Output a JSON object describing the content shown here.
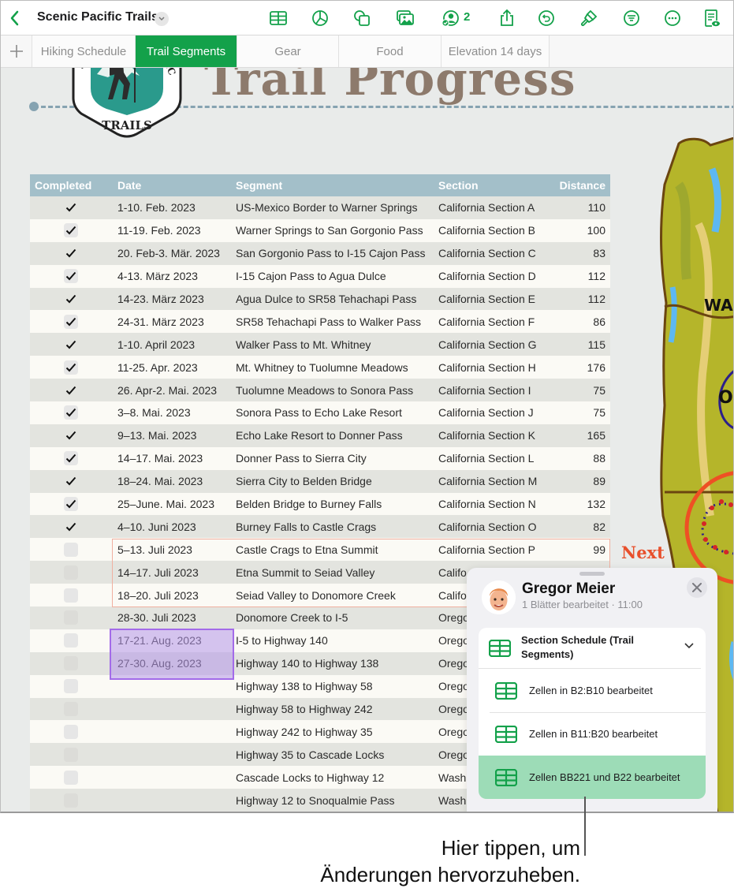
{
  "toolbar": {
    "back_icon": "chevron-left-icon",
    "title": "Scenic Pacific Trails",
    "title_menu_icon": "chevron-down-icon",
    "icons": [
      "table-icon",
      "chart-icon",
      "shapes-icon",
      "media-icon",
      "collaboration-icon",
      "share-icon",
      "undo-icon",
      "format-brush-icon",
      "filter-icon",
      "more-icon",
      "reading-view-icon"
    ],
    "collaborator_count": "2",
    "accent_color": "#13a14a"
  },
  "tabs": {
    "add_icon": "plus-icon",
    "items": [
      {
        "label": "Hiking Schedule",
        "active": false
      },
      {
        "label": "Trail Segments",
        "active": true
      },
      {
        "label": "Gear",
        "active": false
      },
      {
        "label": "Food",
        "active": false
      },
      {
        "label": "Elevation 14 days",
        "active": false
      }
    ]
  },
  "canvas": {
    "title": "Trail Progress",
    "logo": {
      "top_text": "SCENIC PACIFIC",
      "bottom_text": "TRAILS"
    },
    "map_labels": [
      "WA",
      "O"
    ],
    "next_label": "Next"
  },
  "table": {
    "headers": [
      "Completed",
      "Date",
      "Segment",
      "Section",
      "Distance"
    ],
    "rows": [
      {
        "completed": true,
        "date": "1-10. Feb. 2023",
        "segment": "US-Mexico Border to Warner Springs",
        "section": "California Section A",
        "distance": "110"
      },
      {
        "completed": true,
        "date": "11-19. Feb. 2023",
        "segment": "Warner Springs to San Gorgonio Pass",
        "section": "California Section B",
        "distance": "100"
      },
      {
        "completed": true,
        "date": "20. Feb-3. Mär. 2023",
        "segment": "San Gorgonio Pass to I-15 Cajon Pass",
        "section": "California Section C",
        "distance": "83"
      },
      {
        "completed": true,
        "date": "4-13. März 2023",
        "segment": "I-15 Cajon Pass to Agua Dulce",
        "section": "California Section D",
        "distance": "112"
      },
      {
        "completed": true,
        "date": "14-23. März 2023",
        "segment": "Agua Dulce to SR58 Tehachapi Pass",
        "section": "California Section E",
        "distance": "112"
      },
      {
        "completed": true,
        "date": "24-31. März 2023",
        "segment": "SR58 Tehachapi Pass to Walker Pass",
        "section": "California Section F",
        "distance": "86"
      },
      {
        "completed": true,
        "date": "1-10. April 2023",
        "segment": "Walker Pass to Mt. Whitney",
        "section": "California Section G",
        "distance": "115"
      },
      {
        "completed": true,
        "date": "11-25. Apr. 2023",
        "segment": "Mt. Whitney to Tuolumne Meadows",
        "section": "California Section H",
        "distance": "176"
      },
      {
        "completed": true,
        "date": "26. Apr-2. Mai. 2023",
        "segment": "Tuolumne Meadows to Sonora Pass",
        "section": "California Section I",
        "distance": "75"
      },
      {
        "completed": true,
        "date": "3–8. Mai. 2023",
        "segment": "Sonora Pass to Echo Lake Resort",
        "section": "California Section J",
        "distance": "75"
      },
      {
        "completed": true,
        "date": "9–13. Mai. 2023",
        "segment": "Echo Lake Resort to Donner Pass",
        "section": "California Section K",
        "distance": "165"
      },
      {
        "completed": true,
        "date": "14–17. Mai. 2023",
        "segment": "Donner Pass to Sierra City",
        "section": "California Section L",
        "distance": "88"
      },
      {
        "completed": true,
        "date": "18–24. Mai. 2023",
        "segment": "Sierra City to Belden Bridge",
        "section": "California Section M",
        "distance": "89"
      },
      {
        "completed": true,
        "date": "25–June. Mai. 2023",
        "segment": "Belden Bridge to Burney Falls",
        "section": "California Section N",
        "distance": "132"
      },
      {
        "completed": true,
        "date": "4–10. Juni 2023",
        "segment": "Burney Falls to Castle Crags",
        "section": "California Section O",
        "distance": "82"
      },
      {
        "completed": false,
        "date": "5–13. Juli 2023",
        "segment": "Castle Crags to Etna Summit",
        "section": "California Section P",
        "distance": "99"
      },
      {
        "completed": false,
        "date": "14–17. Juli 2023",
        "segment": "Etna Summit to Seiad Valley",
        "section": "Califo",
        "distance": ""
      },
      {
        "completed": false,
        "date": "18–20. Juli 2023",
        "segment": "Seiad Valley to Donomore Creek",
        "section": "Califo",
        "distance": ""
      },
      {
        "completed": false,
        "date": "28-30. Juli 2023",
        "segment": "Donomore Creek to I-5",
        "section": "Orego",
        "distance": ""
      },
      {
        "completed": false,
        "date": "17-21. Aug. 2023",
        "segment": "I-5 to Highway 140",
        "section": "Orego",
        "distance": ""
      },
      {
        "completed": false,
        "date": "27-30. Aug. 2023",
        "segment": "Highway 140 to Highway 138",
        "section": "Orego",
        "distance": ""
      },
      {
        "completed": false,
        "date": "",
        "segment": "Highway 138 to Highway 58",
        "section": "Orego",
        "distance": ""
      },
      {
        "completed": false,
        "date": "",
        "segment": "Highway 58 to Highway 242",
        "section": "Orego",
        "distance": ""
      },
      {
        "completed": false,
        "date": "",
        "segment": "Highway 242 to Highway 35",
        "section": "Orego",
        "distance": ""
      },
      {
        "completed": false,
        "date": "",
        "segment": "Highway 35 to Cascade Locks",
        "section": "Orego",
        "distance": ""
      },
      {
        "completed": false,
        "date": "",
        "segment": "Cascade Locks to Highway 12",
        "section": "Wash",
        "distance": ""
      },
      {
        "completed": false,
        "date": "",
        "segment": "Highway 12 to Snoqualmie Pass",
        "section": "Wash",
        "distance": ""
      }
    ]
  },
  "popover": {
    "user_name": "Gregor Meier",
    "subtitle": "1 Blätter bearbeitet · 11:00",
    "close_icon": "close-icon",
    "sheet": {
      "label": "Section Schedule (Trail Segments)",
      "icon": "table-icon",
      "chevron": "chevron-down-icon"
    },
    "changes": [
      {
        "label": "Zellen in B2:B10 bearbeitet",
        "highlighted": false
      },
      {
        "label": "Zellen in B11:B20 bearbeitet",
        "highlighted": false
      },
      {
        "label": "Zellen BB221 und B22 bearbeitet",
        "highlighted": true
      }
    ],
    "highlight_color": "#9ddcb7"
  },
  "callout": {
    "line1": "Hier tippen, um",
    "line2": "Änderungen hervorzuheben."
  }
}
